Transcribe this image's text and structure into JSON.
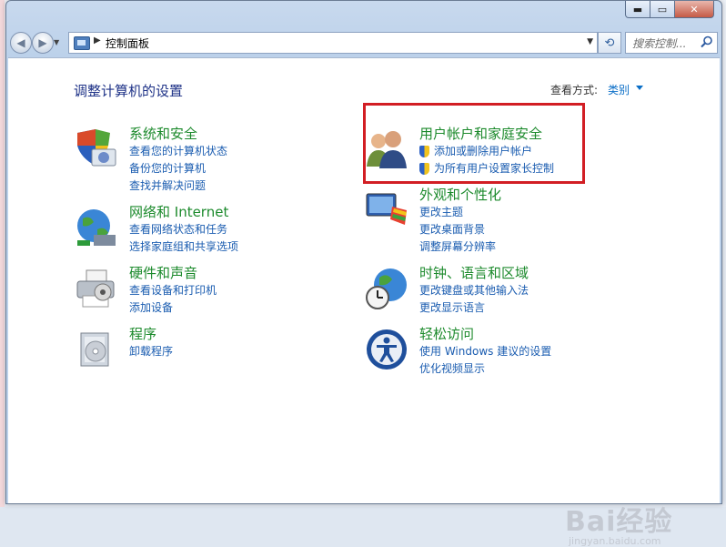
{
  "window": {
    "caption": {
      "minimize": "▬",
      "maximize": "▭",
      "close": "✕"
    }
  },
  "navbar": {
    "address_text": "控制面板",
    "search_placeholder": "搜索控制..."
  },
  "content": {
    "heading": "调整计算机的设置",
    "view_by_label": "查看方式:",
    "view_by_value": "类别"
  },
  "categories": [
    {
      "title": "系统和安全",
      "links": [
        "查看您的计算机状态",
        "备份您的计算机",
        "查找并解决问题"
      ],
      "icon": "shield-icon"
    },
    {
      "title": "网络和 Internet",
      "links": [
        "查看网络状态和任务",
        "选择家庭组和共享选项"
      ],
      "icon": "network-globe-icon"
    },
    {
      "title": "硬件和声音",
      "links": [
        "查看设备和打印机",
        "添加设备"
      ],
      "icon": "printer-icon"
    },
    {
      "title": "程序",
      "links": [
        "卸载程序"
      ],
      "icon": "programs-icon"
    },
    {
      "title": "用户帐户和家庭安全",
      "links": [
        "添加或删除用户帐户",
        "为所有用户设置家长控制"
      ],
      "icon": "users-icon"
    },
    {
      "title": "外观和个性化",
      "links": [
        "更改主题",
        "更改桌面背景",
        "调整屏幕分辨率"
      ],
      "icon": "monitor-paint-icon"
    },
    {
      "title": "时钟、语言和区域",
      "links": [
        "更改键盘或其他输入法",
        "更改显示语言"
      ],
      "icon": "clock-globe-icon"
    },
    {
      "title": "轻松访问",
      "links": [
        "使用 Windows 建议的设置",
        "优化视频显示"
      ],
      "icon": "accessibility-icon"
    }
  ],
  "watermark": {
    "brand": "Bai经验",
    "url": "jingyan.baidu.com"
  }
}
